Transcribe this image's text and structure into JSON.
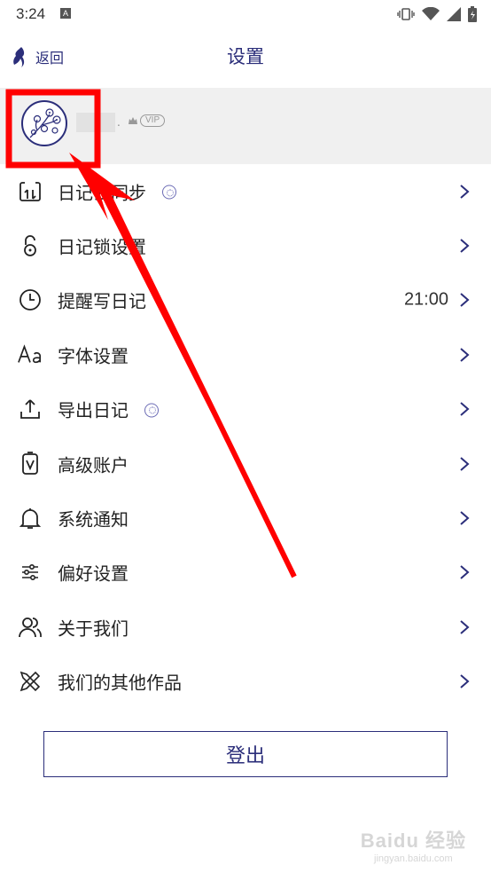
{
  "status_bar": {
    "time": "3:24",
    "notification_badge": "A"
  },
  "header": {
    "back_label": "返回",
    "title": "设置"
  },
  "profile": {
    "vip_label": "VIP",
    "name_suffix": "."
  },
  "menu": {
    "items": [
      {
        "label": "日记云同步",
        "icon": "cloud-sync-icon",
        "value": "",
        "badge": true
      },
      {
        "label": "日记锁设置",
        "icon": "lock-icon",
        "value": "",
        "badge": false
      },
      {
        "label": "提醒写日记",
        "icon": "clock-icon",
        "value": "21:00",
        "badge": false
      },
      {
        "label": "字体设置",
        "icon": "font-icon",
        "value": "",
        "badge": false
      },
      {
        "label": "导出日记",
        "icon": "export-icon",
        "value": "",
        "badge": true
      },
      {
        "label": "高级账户",
        "icon": "premium-account-icon",
        "value": "",
        "badge": false
      },
      {
        "label": "系统通知",
        "icon": "bell-icon",
        "value": "",
        "badge": false
      },
      {
        "label": "偏好设置",
        "icon": "sliders-icon",
        "value": "",
        "badge": false
      },
      {
        "label": "关于我们",
        "icon": "users-icon",
        "value": "",
        "badge": false
      },
      {
        "label": "我们的其他作品",
        "icon": "tools-icon",
        "value": "",
        "badge": false
      }
    ]
  },
  "logout_label": "登出",
  "watermark": {
    "main": "Baidu 经验",
    "sub": "jingyan.baidu.com"
  },
  "colors": {
    "accent": "#2b2e7a",
    "highlight": "#ff0000",
    "profile_bg": "#f0f0f0"
  }
}
